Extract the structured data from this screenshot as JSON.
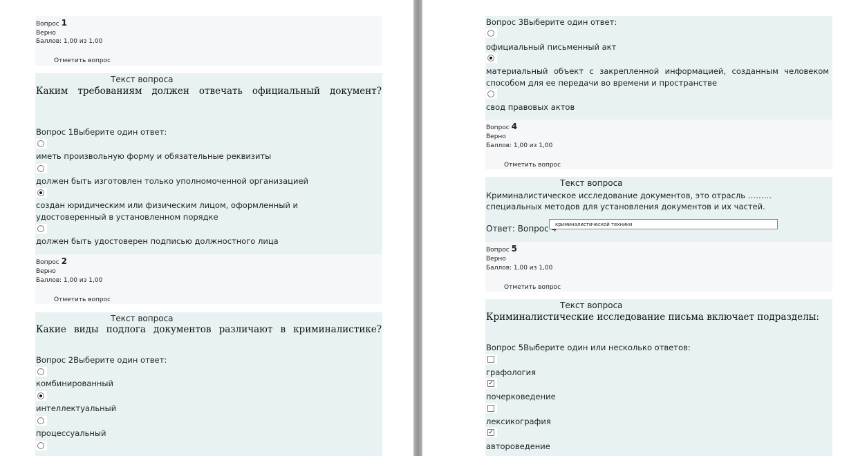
{
  "q1": {
    "info": {
      "label": "Вопрос",
      "number": "1",
      "status": "Верно",
      "grade": "Баллов: 1,00 из 1,00",
      "flag": "Отметить вопрос"
    },
    "heading": "Текст вопроса",
    "text": "Каким требованиям должен отвечать официальный документ?",
    "prompt": "Вопрос 1Выберите один ответ:",
    "options": [
      {
        "label": "иметь произвольную форму и обязательные реквизиты",
        "selected": false
      },
      {
        "label": "должен быть изготовлен только уполномоченной организацией",
        "selected": false
      },
      {
        "label": "создан юридическим или физическим лицом, оформленный и удостоверенный в установленном порядке",
        "selected": true
      },
      {
        "label": "должен быть удостоверен подписью должностного лица",
        "selected": false
      }
    ]
  },
  "q2": {
    "info": {
      "label": "Вопрос",
      "number": "2",
      "status": "Верно",
      "grade": "Баллов: 1,00 из 1,00",
      "flag": "Отметить вопрос"
    },
    "heading": "Текст вопроса",
    "text": "Какие виды подлога документов различают в криминалистике?",
    "prompt": "Вопрос 2Выберите один ответ:",
    "options": [
      {
        "label": "комбинированный",
        "selected": false
      },
      {
        "label": "интеллектуальный",
        "selected": true
      },
      {
        "label": "процессуальный",
        "selected": false
      },
      {
        "label": "",
        "selected": false
      }
    ]
  },
  "q3": {
    "prompt": "Вопрос 3Выберите один ответ:",
    "options": [
      {
        "label": "официальный письменный акт",
        "selected": false
      },
      {
        "label": "материальный объект с закрепленной информацией, созданным человеком способом для ее передачи во времени и пространстве",
        "selected": true
      },
      {
        "label": "свод правовых актов",
        "selected": false
      }
    ]
  },
  "q4": {
    "info": {
      "label": "Вопрос",
      "number": "4",
      "status": "Верно",
      "grade": "Баллов: 1,00 из 1,00",
      "flag": "Отметить вопрос"
    },
    "heading": "Текст вопроса",
    "text": "Криминалистическое исследование документов, это отрасль ……… специальных методов для установления документов и их частей.",
    "answer_label": "Ответ: Вопрос 4",
    "answer_value": "криминалистической техники"
  },
  "q5": {
    "info": {
      "label": "Вопрос",
      "number": "5",
      "status": "Верно",
      "grade": "Баллов: 1,00 из 1,00",
      "flag": "Отметить вопрос"
    },
    "heading": "Текст вопроса",
    "text": "Криминалистические исследование письма включает подразделы:",
    "prompt": "Вопрос 5Выберите один или несколько ответов:",
    "options": [
      {
        "label": "графология",
        "checked": false
      },
      {
        "label": "почерковедение",
        "checked": true
      },
      {
        "label": "лексикография",
        "checked": false
      },
      {
        "label": "автороведение",
        "checked": true
      }
    ]
  }
}
